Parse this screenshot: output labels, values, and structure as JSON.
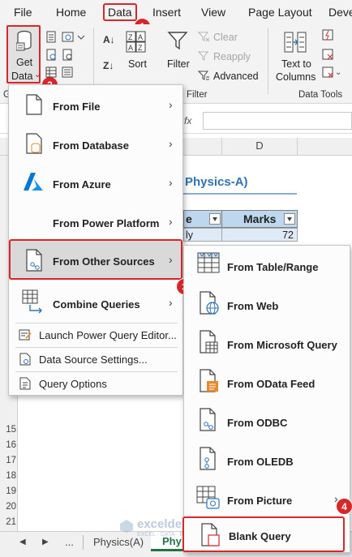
{
  "ribbon": {
    "tabs": [
      "File",
      "Home",
      "Data",
      "Insert",
      "View",
      "Page Layout",
      "Deve"
    ],
    "get_data_line1": "Get",
    "get_data_line2": "Data",
    "sort_label": "Sort",
    "filter_label": "Filter",
    "clear_label": "Clear",
    "reapply_label": "Reapply",
    "advanced_label": "Advanced",
    "group_sort_filter": "Filter",
    "text_to_columns_line1": "Text to",
    "text_to_columns_line2": "Columns",
    "group_data_tools": "Data Tools",
    "group_get_partial": "G",
    "formula_fx": "fx"
  },
  "badges": [
    "1",
    "2",
    "3",
    "4"
  ],
  "sheet": {
    "column_d": "D",
    "title_partial": "Physics-A)",
    "header_partial": "e",
    "marks_header": "Marks",
    "cell_partial": "ly",
    "marks_value": "72",
    "row_numbers": [
      "15",
      "16",
      "17",
      "18",
      "19",
      "20",
      "21"
    ],
    "tabs": [
      "...",
      "Physics(A)",
      "Phy"
    ]
  },
  "get_data_menu": {
    "from_file": "From File",
    "from_database": "From Database",
    "from_azure": "From Azure",
    "from_power_platform": "From Power Platform",
    "from_other_sources": "From Other Sources",
    "combine_queries": "Combine Queries",
    "launch_editor": "Launch Power Query Editor...",
    "data_source_settings": "Data Source Settings...",
    "query_options": "Query Options"
  },
  "other_sources_menu": {
    "table_range": "From Table/Range",
    "web": "From Web",
    "microsoft_query": "From Microsoft Query",
    "odata_feed": "From OData Feed",
    "odbc": "From ODBC",
    "oledb": "From OLEDB",
    "picture": "From Picture",
    "blank_query": "Blank Query"
  },
  "watermark": {
    "name": "exceldemy",
    "tagline": "EXCEL · DATA · BI"
  },
  "colors": {
    "highlight_red": "#d9262a",
    "excel_green": "#217346",
    "azure_blue": "#0078d4",
    "title_blue": "#2e74b5",
    "header_fill": "#bdd7ee"
  }
}
